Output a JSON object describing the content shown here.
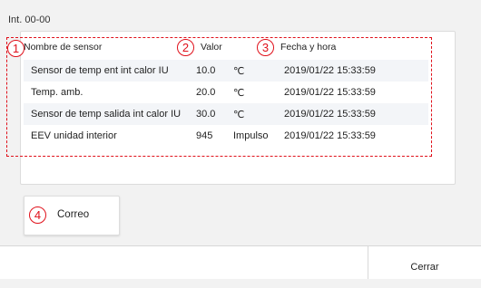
{
  "screen": {
    "title": "Int. 00-00",
    "highlight_color": "#e0101a"
  },
  "table": {
    "headers": {
      "name": "Nombre de sensor",
      "value": "Valor",
      "datetime": "Fecha y hora"
    },
    "rows": [
      {
        "name": "Sensor de temp ent int calor IU",
        "value": "10.0",
        "unit": "℃",
        "datetime": "2019/01/22 15:33:59"
      },
      {
        "name": "Temp. amb.",
        "value": "20.0",
        "unit": "℃",
        "datetime": "2019/01/22 15:33:59"
      },
      {
        "name": "Sensor de temp salida int calor IU",
        "value": "30.0",
        "unit": "℃",
        "datetime": "2019/01/22 15:33:59"
      },
      {
        "name": "EEV unidad interior",
        "value": "945",
        "unit": "Impulso",
        "datetime": "2019/01/22 15:33:59"
      }
    ]
  },
  "callouts": [
    "1",
    "2",
    "3",
    "4"
  ],
  "mail_button": {
    "label": "Correo"
  },
  "footer": {
    "close_label": "Cerrar"
  }
}
